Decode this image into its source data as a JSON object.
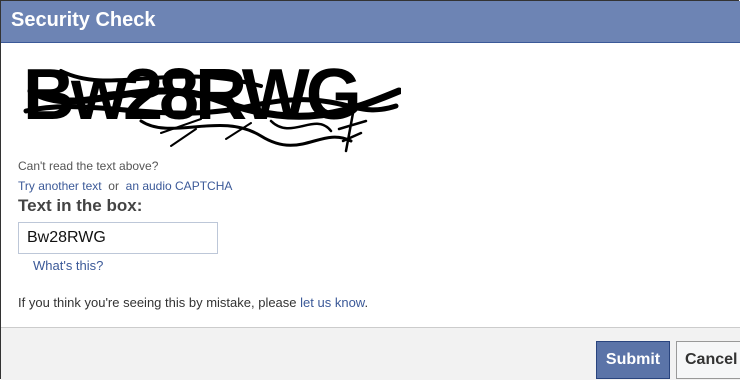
{
  "dialog": {
    "title": "Security Check"
  },
  "captcha": {
    "image_text": "Bw28RWG",
    "cant_read": "Can't read the text above?",
    "try_another": "Try another text",
    "or": "or",
    "audio_captcha": "an audio CAPTCHA"
  },
  "form": {
    "label": "Text in the box:",
    "input_value": "Bw28RWG",
    "whats_this": "What's this?"
  },
  "notice": {
    "text": "If you think you're seeing this by mistake, please",
    "link": "let us know",
    "end": "."
  },
  "buttons": {
    "submit": "Submit",
    "cancel": "Cancel"
  },
  "colors": {
    "titlebar": "#6d84b4",
    "link": "#3b5998",
    "submit_bg": "#5b74a8"
  }
}
